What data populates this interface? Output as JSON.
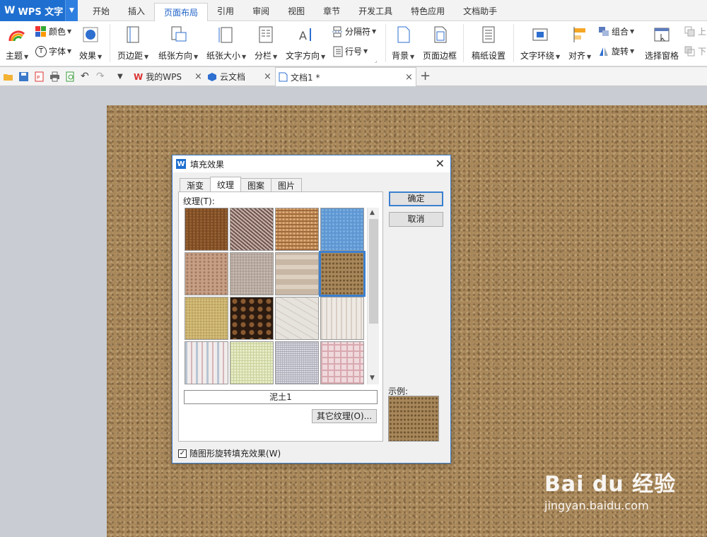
{
  "app": {
    "name": "WPS 文字",
    "logo": "W"
  },
  "ribbon_tabs": [
    "开始",
    "插入",
    "页面布局",
    "引用",
    "审阅",
    "视图",
    "章节",
    "开发工具",
    "特色应用",
    "文档助手"
  ],
  "ribbon": {
    "theme": "主题",
    "color": "颜色",
    "font": "字体",
    "effect": "效果",
    "margins": "页边距",
    "orientation": "纸张方向",
    "size": "纸张大小",
    "columns": "分栏",
    "text_direction": "文字方向",
    "separator": "分隔符",
    "line_numbers": "行号",
    "background": "背景",
    "page_border": "页面边框",
    "paper_setup": "稿纸设置",
    "text_wrap": "文字环绕",
    "align": "对齐",
    "group": "组合",
    "rotate": "旋转",
    "selection_pane": "选择窗格",
    "bring_forward": "上",
    "send_backward": "下"
  },
  "doc_tabs": [
    {
      "label": "我的WPS"
    },
    {
      "label": "云文档"
    },
    {
      "label": "文档1 *"
    }
  ],
  "dialog": {
    "title": "填充效果",
    "tabs": [
      "渐变",
      "纹理",
      "图案",
      "图片"
    ],
    "texture_label": "纹理(T):",
    "selected_name": "泥土1",
    "other_button": "其它纹理(O)...",
    "ok": "确定",
    "cancel": "取消",
    "sample_label": "示例:",
    "checkbox_label": "随图形旋转填充效果(W)",
    "checkbox_checked": true
  },
  "colors": {
    "accent": "#1e6fd0",
    "page_texture": "#a8875a"
  },
  "watermark": {
    "logo": "Bai du 经验",
    "url": "jingyan.baidu.com"
  }
}
